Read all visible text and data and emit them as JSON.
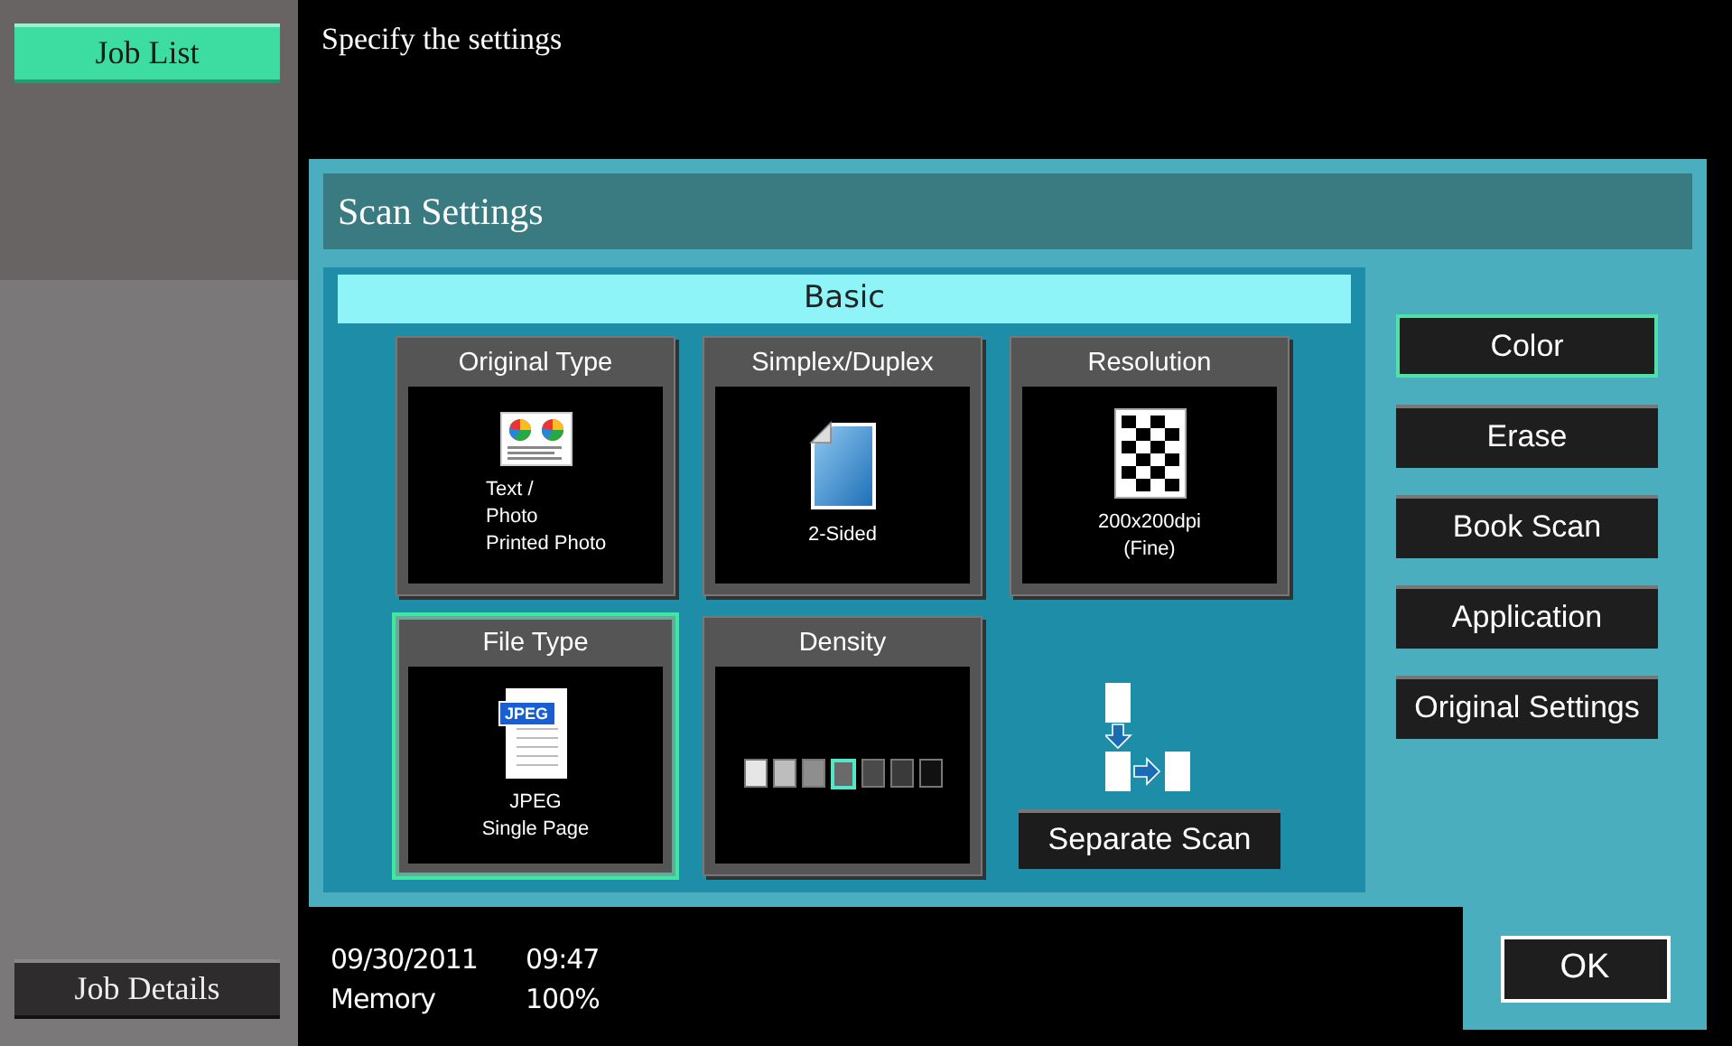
{
  "sidebar": {
    "job_list": "Job List",
    "job_details": "Job Details"
  },
  "message": "Specify the settings",
  "panel": {
    "title": "Scan Settings",
    "section": "Basic",
    "tiles": [
      {
        "title": "Original Type",
        "kind": "photo",
        "lines": [
          "Text /",
          "Photo",
          "Printed Photo"
        ],
        "selected": false
      },
      {
        "title": "Simplex/Duplex",
        "kind": "duplex",
        "lines": [
          "2-Sided"
        ],
        "selected": false
      },
      {
        "title": "Resolution",
        "kind": "checker",
        "lines": [
          "200x200dpi",
          "(Fine)"
        ],
        "selected": false
      },
      {
        "title": "File Type",
        "kind": "jpeg",
        "badge": "JPEG",
        "lines": [
          "JPEG",
          "Single Page"
        ],
        "selected": true
      },
      {
        "title": "Density",
        "kind": "density",
        "selected": false,
        "cells": [
          {
            "color": "#e6e6e6",
            "selected": false
          },
          {
            "color": "#bdbdbd",
            "selected": false
          },
          {
            "color": "#8e8e8e",
            "selected": false
          },
          {
            "color": "#6a6a6a",
            "selected": true
          },
          {
            "color": "#4a4a4a",
            "selected": false
          },
          {
            "color": "#3a3a3a",
            "selected": false
          },
          {
            "color": "#111111",
            "selected": false
          }
        ]
      }
    ],
    "separate_scan": "Separate Scan",
    "side_buttons": [
      {
        "label": "Color",
        "selected": true
      },
      {
        "label": "Erase",
        "selected": false
      },
      {
        "label": "Book Scan",
        "selected": false
      },
      {
        "label": "Application",
        "selected": false
      },
      {
        "label": "Original Settings",
        "selected": false
      }
    ]
  },
  "status": {
    "date": "09/30/2011",
    "time": "09:47",
    "memory_label": "Memory",
    "memory": "100%"
  },
  "ok": "OK"
}
